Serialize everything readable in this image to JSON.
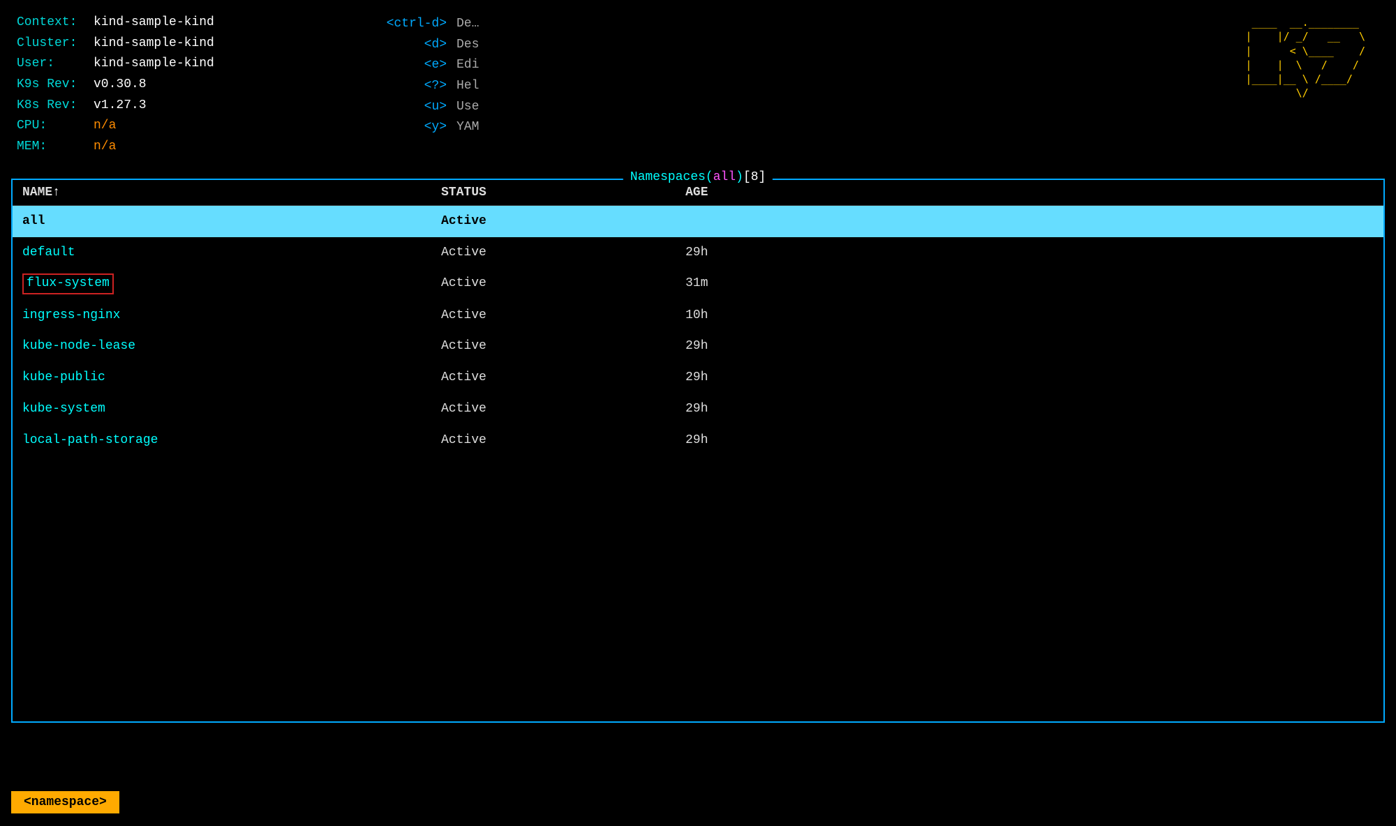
{
  "header": {
    "context_label": "Context:",
    "context_value": "kind-sample-kind",
    "cluster_label": "Cluster:",
    "cluster_value": "kind-sample-kind",
    "user_label": "User:",
    "user_value": "kind-sample-kind",
    "k9s_rev_label": "K9s Rev:",
    "k9s_rev_value": "v0.30.8",
    "k8s_rev_label": "K8s Rev:",
    "k8s_rev_value": "v1.27.3",
    "cpu_label": "CPU:",
    "cpu_value": "n/a",
    "mem_label": "MEM:",
    "mem_value": "n/a"
  },
  "shortcuts": [
    {
      "key": "<ctrl-d>",
      "desc": "De…"
    },
    {
      "key": "<d>",
      "desc": "Des"
    },
    {
      "key": "<e>",
      "desc": "Edi"
    },
    {
      "key": "<?>",
      "desc": "Hel"
    },
    {
      "key": "<u>",
      "desc": "Use"
    },
    {
      "key": "<y>",
      "desc": "YAM"
    }
  ],
  "logo_ascii": "---- .----.\n|/ _  --  .--------.\n<  \\___ /  __----  |\n|    |  /  /\\___  |\n|____|_/\\ //__// >\n      \\/       \\/",
  "panel": {
    "title_prefix": "Namespaces(",
    "title_all": "all",
    "title_suffix": ")[8]",
    "columns": {
      "name": "NAME↑",
      "status": "STATUS",
      "age": "AGE"
    },
    "rows": [
      {
        "name": "all",
        "status": "Active",
        "age": "",
        "selected": true
      },
      {
        "name": "default",
        "status": "Active",
        "age": "29h",
        "selected": false
      },
      {
        "name": "flux-system",
        "status": "Active",
        "age": "31m",
        "selected": false,
        "boxed": true
      },
      {
        "name": "ingress-nginx",
        "status": "Active",
        "age": "10h",
        "selected": false
      },
      {
        "name": "kube-node-lease",
        "status": "Active",
        "age": "29h",
        "selected": false
      },
      {
        "name": "kube-public",
        "status": "Active",
        "age": "29h",
        "selected": false
      },
      {
        "name": "kube-system",
        "status": "Active",
        "age": "29h",
        "selected": false
      },
      {
        "name": "local-path-storage",
        "status": "Active",
        "age": "29h",
        "selected": false
      }
    ]
  },
  "bottom": {
    "namespace_badge": "<namespace>"
  }
}
